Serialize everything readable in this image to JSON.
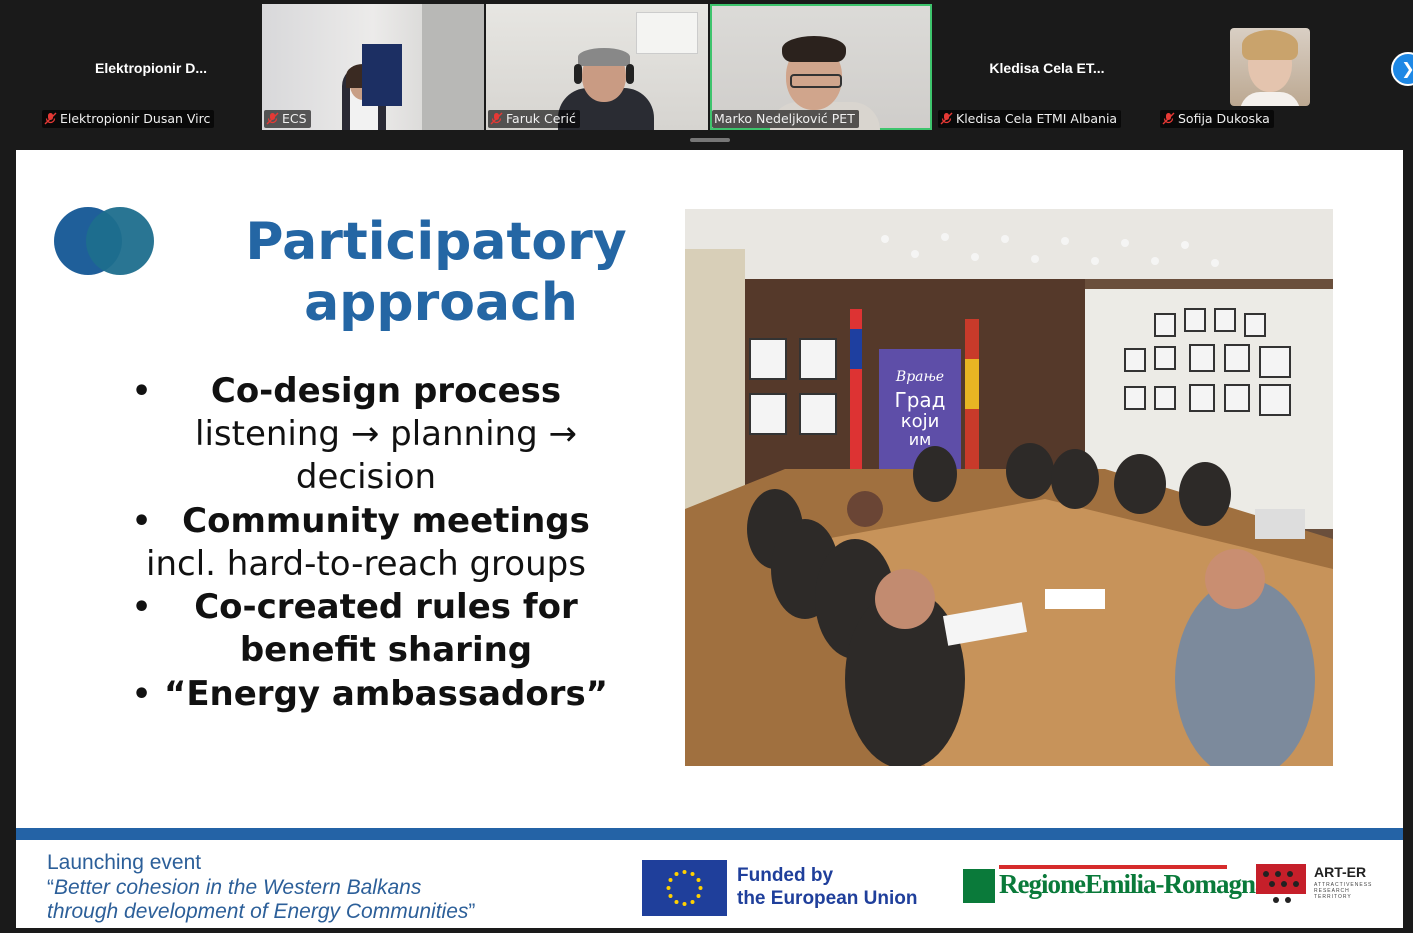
{
  "participants": [
    {
      "tile_title": "Elektropionir  D...",
      "tag": "Elektropionir Dusan Virc",
      "muted": true
    },
    {
      "tile_title": "",
      "tag": "ECS",
      "muted": true
    },
    {
      "tile_title": "",
      "tag": "Faruk Cerić",
      "muted": true
    },
    {
      "tile_title": "",
      "tag": "Marko Nedeljković PET",
      "muted": false,
      "active_speaker": true
    },
    {
      "tile_title": "Kledisa Cela   ET...",
      "tag": "Kledisa Cela  ETMI Albania",
      "muted": true
    },
    {
      "tile_title": "",
      "tag": "Sofija Dukoska",
      "muted": true
    }
  ],
  "next_page_icon": "chevron-right-icon",
  "slide": {
    "title_line1": "Participatory",
    "title_line2": "approach",
    "bullets": [
      {
        "bold": "Co-design process",
        "sub": [
          "listening → planning →",
          "decision"
        ]
      },
      {
        "bold": "Community meetings",
        "sub": [
          "incl. hard-to-reach groups"
        ]
      },
      {
        "bold": "Co-created rules for",
        "bold2": "benefit sharing",
        "sub": []
      },
      {
        "bold": "“Energy ambassadors”",
        "sub": []
      }
    ],
    "bullet_char": "•",
    "photo_banner_text": [
      "Врање",
      "Град",
      "који",
      "им"
    ],
    "footer": {
      "line1": "Launching event",
      "line2_quote": "“",
      "line2": "Better cohesion in the Western Balkans",
      "line3": "through development of Energy Communities",
      "line3_quote": "”"
    },
    "eu_text_1": "Funded by",
    "eu_text_2": "the European Union",
    "region_logo_text": "RegioneEmilia-Romagna",
    "arter_title": "ART-ER",
    "arter_sub": "ATTRACTIVENESS RESEARCH TERRITORY"
  },
  "colors": {
    "title_blue": "#2466a4",
    "band_blue": "#2463a6",
    "eu_blue": "#1f3f9b",
    "region_green": "#0a7a3a",
    "active_outline": "#3ec46d"
  }
}
